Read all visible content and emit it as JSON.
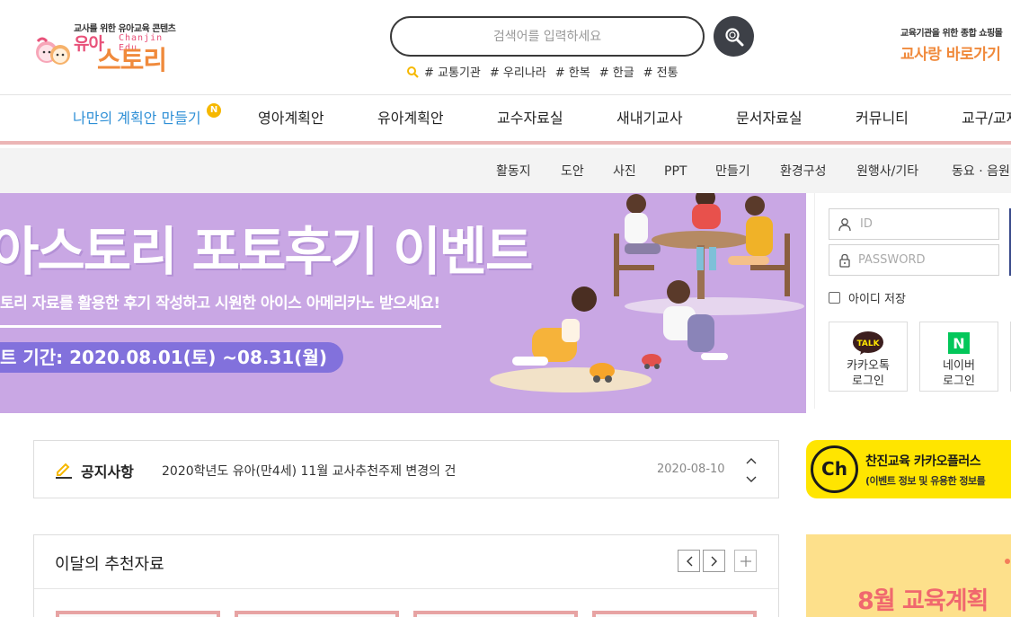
{
  "logo": {
    "tagline": "교사를 위한 유아교육 콘텐츠",
    "brand_main": "유아",
    "brand_eng": "Chanjin Edu",
    "brand_sub": "스토리"
  },
  "search": {
    "placeholder": "검색어를 입력하세요",
    "tags": [
      "# 교통기관",
      "# 우리나라",
      "# 한복",
      "# 한글",
      "# 전통"
    ]
  },
  "shop_link": {
    "sub": "교육기관을 위한 종합 쇼핑몰",
    "main": "교사랑 바로가기"
  },
  "main_nav": {
    "items": [
      "나만의 계획안 만들기",
      "영아계획안",
      "유아계획안",
      "교수자료실",
      "새내기교사",
      "문서자료실",
      "커뮤니티",
      "교구/교재"
    ],
    "badge": "N"
  },
  "sub_nav": {
    "items": [
      "활동지",
      "도안",
      "사진",
      "PPT",
      "만들기",
      "환경구성",
      "원행사/기타",
      "동요 · 음원"
    ]
  },
  "banner": {
    "title": "아스토리 포토후기 이벤트",
    "subtitle": "토리 자료를 활용한 후기 작성하고 시원한 아이스 아메리카노 받으세요!",
    "period": "트 기간: 2020.08.01(토) ~08.31(월)"
  },
  "login": {
    "id_placeholder": "ID",
    "password_placeholder": "PASSWORD",
    "remember_label": "아이디 저장",
    "kakao_icon_text": "TALK",
    "kakao_line1": "카카오톡",
    "kakao_line2": "로그인",
    "naver_icon_text": "N",
    "naver_line1": "네이버",
    "naver_line2": "로그인"
  },
  "notice": {
    "label": "공지사항",
    "text": "2020학년도 유아(만4세) 11월 교사추천주제 변경의 건",
    "date": "2020-08-10"
  },
  "kakao_plus": {
    "icon_text": "Ch",
    "title": "찬진교육 카카오플러스",
    "desc": "(이벤트 정보 및 유용한 정보를"
  },
  "recommend": {
    "title": "이달의 추천자료"
  },
  "side_event": {
    "text": "8월 교육계획"
  },
  "colors": {
    "nav_active": "#2e8fd6",
    "nav_underline": "#ecb6b6",
    "banner_bg": "#c9a7e4",
    "banner_period_bg": "#8271dc",
    "kakao_yellow": "#ffe500",
    "naver_green": "#03c75a",
    "brand_orange": "#f08a3c",
    "brand_pink": "#e8527a"
  },
  "icons": [
    "search-icon",
    "search-tag-icon",
    "user-icon",
    "lock-icon",
    "kakao-talk-icon",
    "naver-icon",
    "pencil-icon",
    "chevron-up-icon",
    "chevron-down-icon",
    "chevron-left-icon",
    "chevron-right-icon",
    "plus-icon"
  ]
}
